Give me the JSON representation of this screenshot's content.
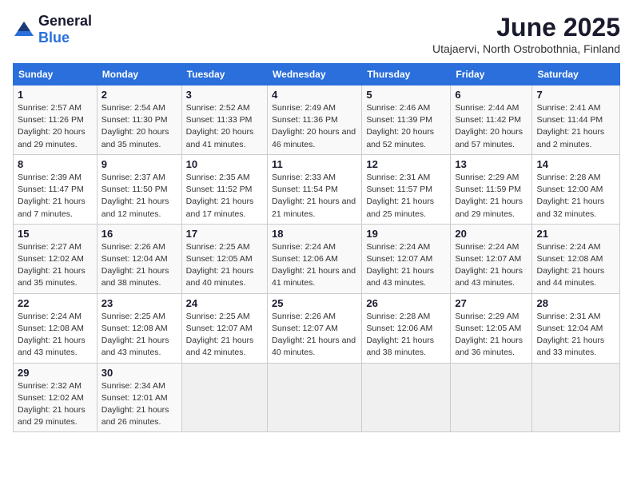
{
  "logo": {
    "text_general": "General",
    "text_blue": "Blue"
  },
  "title": "June 2025",
  "subtitle": "Utajaervi, North Ostrobothnia, Finland",
  "headers": [
    "Sunday",
    "Monday",
    "Tuesday",
    "Wednesday",
    "Thursday",
    "Friday",
    "Saturday"
  ],
  "weeks": [
    [
      {
        "day": "1",
        "sunrise": "Sunrise: 2:57 AM",
        "sunset": "Sunset: 11:26 PM",
        "daylight": "Daylight: 20 hours and 29 minutes."
      },
      {
        "day": "2",
        "sunrise": "Sunrise: 2:54 AM",
        "sunset": "Sunset: 11:30 PM",
        "daylight": "Daylight: 20 hours and 35 minutes."
      },
      {
        "day": "3",
        "sunrise": "Sunrise: 2:52 AM",
        "sunset": "Sunset: 11:33 PM",
        "daylight": "Daylight: 20 hours and 41 minutes."
      },
      {
        "day": "4",
        "sunrise": "Sunrise: 2:49 AM",
        "sunset": "Sunset: 11:36 PM",
        "daylight": "Daylight: 20 hours and 46 minutes."
      },
      {
        "day": "5",
        "sunrise": "Sunrise: 2:46 AM",
        "sunset": "Sunset: 11:39 PM",
        "daylight": "Daylight: 20 hours and 52 minutes."
      },
      {
        "day": "6",
        "sunrise": "Sunrise: 2:44 AM",
        "sunset": "Sunset: 11:42 PM",
        "daylight": "Daylight: 20 hours and 57 minutes."
      },
      {
        "day": "7",
        "sunrise": "Sunrise: 2:41 AM",
        "sunset": "Sunset: 11:44 PM",
        "daylight": "Daylight: 21 hours and 2 minutes."
      }
    ],
    [
      {
        "day": "8",
        "sunrise": "Sunrise: 2:39 AM",
        "sunset": "Sunset: 11:47 PM",
        "daylight": "Daylight: 21 hours and 7 minutes."
      },
      {
        "day": "9",
        "sunrise": "Sunrise: 2:37 AM",
        "sunset": "Sunset: 11:50 PM",
        "daylight": "Daylight: 21 hours and 12 minutes."
      },
      {
        "day": "10",
        "sunrise": "Sunrise: 2:35 AM",
        "sunset": "Sunset: 11:52 PM",
        "daylight": "Daylight: 21 hours and 17 minutes."
      },
      {
        "day": "11",
        "sunrise": "Sunrise: 2:33 AM",
        "sunset": "Sunset: 11:54 PM",
        "daylight": "Daylight: 21 hours and 21 minutes."
      },
      {
        "day": "12",
        "sunrise": "Sunrise: 2:31 AM",
        "sunset": "Sunset: 11:57 PM",
        "daylight": "Daylight: 21 hours and 25 minutes."
      },
      {
        "day": "13",
        "sunrise": "Sunrise: 2:29 AM",
        "sunset": "Sunset: 11:59 PM",
        "daylight": "Daylight: 21 hours and 29 minutes."
      },
      {
        "day": "14",
        "sunrise": "Sunrise: 2:28 AM",
        "sunset": "Sunset: 12:00 AM",
        "daylight": "Daylight: 21 hours and 32 minutes."
      }
    ],
    [
      {
        "day": "15",
        "sunrise": "Sunrise: 2:27 AM",
        "sunset": "Sunset: 12:02 AM",
        "daylight": "Daylight: 21 hours and 35 minutes."
      },
      {
        "day": "16",
        "sunrise": "Sunrise: 2:26 AM",
        "sunset": "Sunset: 12:04 AM",
        "daylight": "Daylight: 21 hours and 38 minutes."
      },
      {
        "day": "17",
        "sunrise": "Sunrise: 2:25 AM",
        "sunset": "Sunset: 12:05 AM",
        "daylight": "Daylight: 21 hours and 40 minutes."
      },
      {
        "day": "18",
        "sunrise": "Sunrise: 2:24 AM",
        "sunset": "Sunset: 12:06 AM",
        "daylight": "Daylight: 21 hours and 41 minutes."
      },
      {
        "day": "19",
        "sunrise": "Sunrise: 2:24 AM",
        "sunset": "Sunset: 12:07 AM",
        "daylight": "Daylight: 21 hours and 43 minutes."
      },
      {
        "day": "20",
        "sunrise": "Sunrise: 2:24 AM",
        "sunset": "Sunset: 12:07 AM",
        "daylight": "Daylight: 21 hours and 43 minutes."
      },
      {
        "day": "21",
        "sunrise": "Sunrise: 2:24 AM",
        "sunset": "Sunset: 12:08 AM",
        "daylight": "Daylight: 21 hours and 44 minutes."
      }
    ],
    [
      {
        "day": "22",
        "sunrise": "Sunrise: 2:24 AM",
        "sunset": "Sunset: 12:08 AM",
        "daylight": "Daylight: 21 hours and 43 minutes."
      },
      {
        "day": "23",
        "sunrise": "Sunrise: 2:25 AM",
        "sunset": "Sunset: 12:08 AM",
        "daylight": "Daylight: 21 hours and 43 minutes."
      },
      {
        "day": "24",
        "sunrise": "Sunrise: 2:25 AM",
        "sunset": "Sunset: 12:07 AM",
        "daylight": "Daylight: 21 hours and 42 minutes."
      },
      {
        "day": "25",
        "sunrise": "Sunrise: 2:26 AM",
        "sunset": "Sunset: 12:07 AM",
        "daylight": "Daylight: 21 hours and 40 minutes."
      },
      {
        "day": "26",
        "sunrise": "Sunrise: 2:28 AM",
        "sunset": "Sunset: 12:06 AM",
        "daylight": "Daylight: 21 hours and 38 minutes."
      },
      {
        "day": "27",
        "sunrise": "Sunrise: 2:29 AM",
        "sunset": "Sunset: 12:05 AM",
        "daylight": "Daylight: 21 hours and 36 minutes."
      },
      {
        "day": "28",
        "sunrise": "Sunrise: 2:31 AM",
        "sunset": "Sunset: 12:04 AM",
        "daylight": "Daylight: 21 hours and 33 minutes."
      }
    ],
    [
      {
        "day": "29",
        "sunrise": "Sunrise: 2:32 AM",
        "sunset": "Sunset: 12:02 AM",
        "daylight": "Daylight: 21 hours and 29 minutes."
      },
      {
        "day": "30",
        "sunrise": "Sunrise: 2:34 AM",
        "sunset": "Sunset: 12:01 AM",
        "daylight": "Daylight: 21 hours and 26 minutes."
      },
      null,
      null,
      null,
      null,
      null
    ]
  ]
}
